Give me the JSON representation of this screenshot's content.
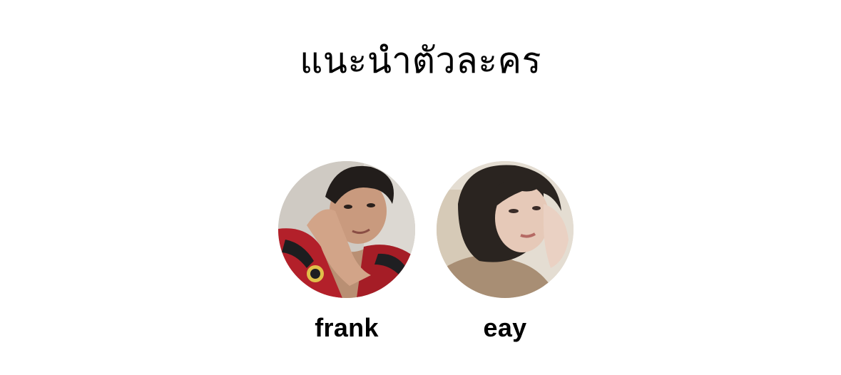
{
  "page": {
    "title": "แนะนำตัวละคร"
  },
  "cast": [
    {
      "name": "frank",
      "avatar_icon": "portrait-photo"
    },
    {
      "name": "eay",
      "avatar_icon": "portrait-photo"
    }
  ]
}
